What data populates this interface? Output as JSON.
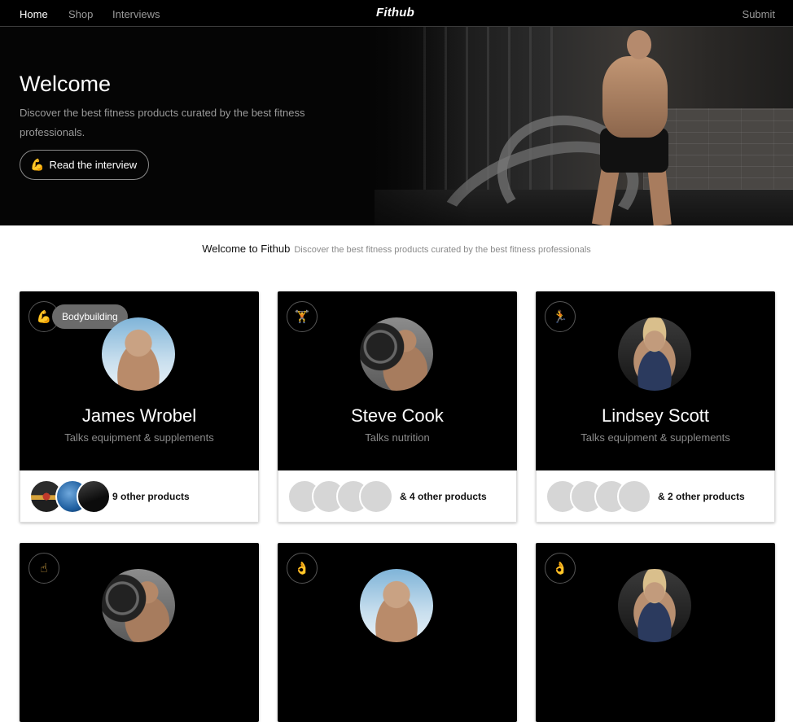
{
  "nav": {
    "home": "Home",
    "shop": "Shop",
    "interviews": "Interviews",
    "logo": "Fithub",
    "submit": "Submit"
  },
  "hero": {
    "title": "Welcome",
    "description": "Discover the best fitness products curated by the best fitness professionals.",
    "cta_emoji": "💪",
    "cta_label": "Read the interview"
  },
  "intro": {
    "title": "Welcome to Fithub",
    "subtitle": "Discover the best fitness products curated by the best fitness professionals"
  },
  "cards": [
    {
      "category_emoji": "💪",
      "category_tag": "Bodybuilding",
      "name": "James Wrobel",
      "subtitle": "Talks equipment & supplements",
      "more": "& 9 other products"
    },
    {
      "category_emoji": "🏋",
      "name": "Steve Cook",
      "subtitle": "Talks nutrition",
      "more": "& 4 other products"
    },
    {
      "category_emoji": "🏃",
      "name": "Lindsey Scott",
      "subtitle": "Talks equipment & supplements",
      "more": "& 2 other products"
    },
    {
      "category_emoji": "☝"
    },
    {
      "category_emoji": "👌"
    },
    {
      "category_emoji": "👌"
    }
  ]
}
